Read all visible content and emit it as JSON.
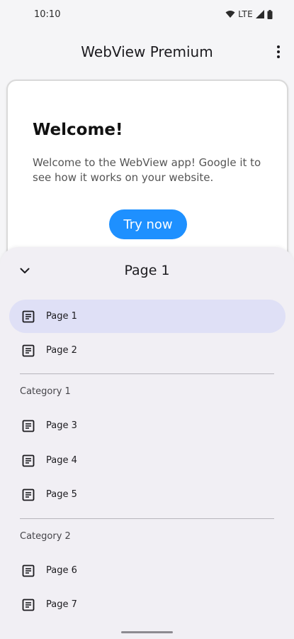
{
  "status_bar": {
    "time": "10:10",
    "network": "LTE",
    "icons": [
      "wifi-icon",
      "signal-icon",
      "battery-icon"
    ]
  },
  "app_bar": {
    "title": "WebView Premium",
    "overflow_icon": "more-vertical-icon"
  },
  "web_content": {
    "heading": "Welcome!",
    "body": "Welcome to the WebView app! Google it to see how it works on your website.",
    "button_label": "Try now"
  },
  "sheet": {
    "title": "Page 1",
    "collapse_icon": "chevron-down-icon",
    "item_icon": "document-icon",
    "items": [
      {
        "label": "Page 1",
        "active": true
      },
      {
        "label": "Page 2"
      },
      {
        "label": "Page 3"
      },
      {
        "label": "Page 4"
      },
      {
        "label": "Page 5"
      },
      {
        "label": "Page 6"
      },
      {
        "label": "Page 7"
      }
    ],
    "categories": [
      "Category 1",
      "Category 2"
    ]
  },
  "colors": {
    "accent_button": "#1e90ff",
    "active_item_bg": "#dfe0f6",
    "sheet_bg": "#f1eff4",
    "page_bg": "#f5f5f7"
  }
}
